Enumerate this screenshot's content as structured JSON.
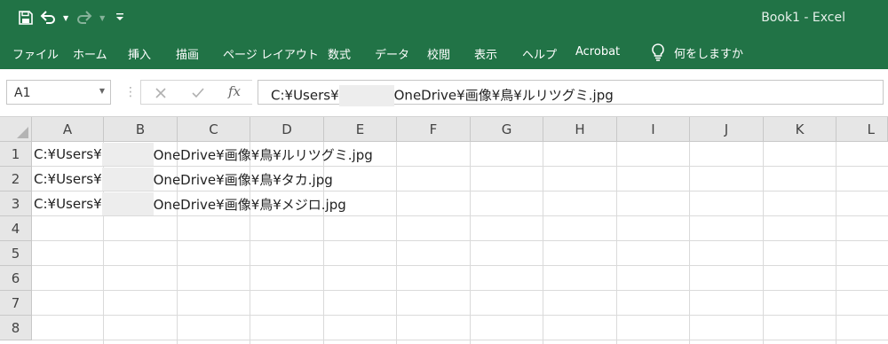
{
  "window": {
    "title": "Book1  -  Excel"
  },
  "qat": {
    "save": "save-icon",
    "undo": "undo-icon",
    "redo": "redo-icon",
    "customize": "customize-quick-access-icon"
  },
  "ribbon": {
    "tabs": [
      "ファイル",
      "ホーム",
      "挿入",
      "描画",
      "ページ レイアウト",
      "数式",
      "データ",
      "校閲",
      "表示",
      "ヘルプ",
      "Acrobat"
    ],
    "tell_me": "何をしますか"
  },
  "formula_bar": {
    "name_box": "A1",
    "fx": "fx",
    "value_prefix": "C:¥Users¥",
    "value_suffix": "OneDrive¥画像¥鳥¥ルリツグミ.jpg"
  },
  "sheet": {
    "columns": [
      "A",
      "B",
      "C",
      "D",
      "E",
      "F",
      "G",
      "H",
      "I",
      "J",
      "K",
      "L"
    ],
    "rows": [
      "1",
      "2",
      "3",
      "4",
      "5",
      "6",
      "7",
      "8"
    ],
    "cells": [
      {
        "ref": "A1",
        "prefix": "C:¥Users¥",
        "suffix": "OneDrive¥画像¥鳥¥ルリツグミ.jpg"
      },
      {
        "ref": "A2",
        "prefix": "C:¥Users¥",
        "suffix": "OneDrive¥画像¥鳥¥タカ.jpg"
      },
      {
        "ref": "A3",
        "prefix": "C:¥Users¥",
        "suffix": "OneDrive¥画像¥鳥¥メジロ.jpg"
      }
    ]
  },
  "colors": {
    "excel_green": "#217346",
    "header_gray": "#e6e6e6",
    "gridline": "#dadada"
  }
}
